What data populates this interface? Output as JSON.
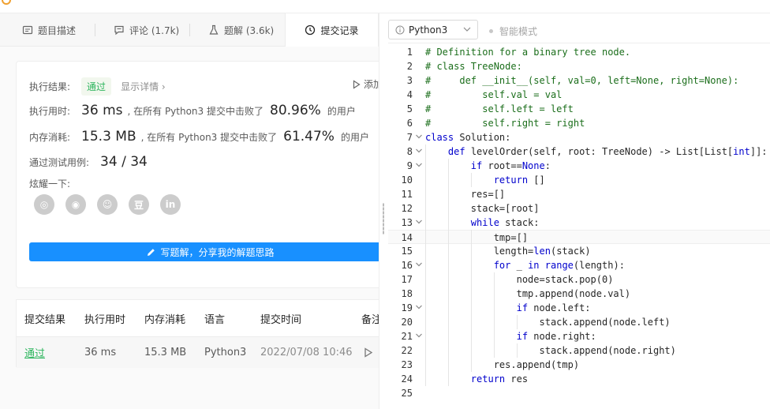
{
  "tabs": [
    {
      "label": "题目描述",
      "icon": "document-icon"
    },
    {
      "label": "评论 (1.7k)",
      "icon": "comment-icon"
    },
    {
      "label": "题解 (3.6k)",
      "icon": "flask-icon"
    },
    {
      "label": "提交记录",
      "icon": "clock-icon"
    }
  ],
  "result": {
    "label": "执行结果:",
    "status": "通过",
    "details_link": "显示详情 ›",
    "add_note": "添加备",
    "runtime_label": "执行用时:",
    "runtime_value": "36 ms",
    "runtime_text_a": ", 在所有 Python3 提交中击败了",
    "runtime_pct": "80.96%",
    "runtime_text_b": "的用户",
    "memory_label": "内存消耗:",
    "memory_value": "15.3 MB",
    "memory_text_a": ", 在所有 Python3 提交中击败了",
    "memory_pct": "61.47%",
    "memory_text_b": "的用户",
    "tests_label": "通过测试用例:",
    "tests_value": "34 / 34",
    "share_label": "炫耀一下:",
    "share_icons": [
      "wechat-icon",
      "weibo-icon",
      "qq-icon",
      "douban-icon",
      "linkedin-icon"
    ],
    "share_glyphs": [
      "◎",
      "◉",
      "☺",
      "豆",
      "in"
    ],
    "write_button": "写题解，分享我的解题思路"
  },
  "table": {
    "headers": [
      "提交结果",
      "执行用时",
      "内存消耗",
      "语言",
      "提交时间",
      "备注"
    ],
    "row": {
      "status": "通过",
      "runtime": "36 ms",
      "memory": "15.3 MB",
      "language": "Python3",
      "time": "2022/07/08 10:46"
    }
  },
  "editor": {
    "language": "Python3",
    "smart_mode": "智能模式",
    "current_line": 14,
    "lines": [
      "# Definition for a binary tree node.",
      "# class TreeNode:",
      "#     def __init__(self, val=0, left=None, right=None):",
      "#         self.val = val",
      "#         self.left = left",
      "#         self.right = right",
      "class Solution:",
      "    def levelOrder(self, root: TreeNode) -> List[List[int]]:",
      "        if root==None:",
      "            return []",
      "        res=[]",
      "        stack=[root]",
      "        while stack:",
      "            tmp=[]",
      "            length=len(stack)",
      "            for _ in range(length):",
      "                node=stack.pop(0)",
      "                tmp.append(node.val)",
      "                if node.left:",
      "                    stack.append(node.left)",
      "                if node.right:",
      "                    stack.append(node.right)",
      "            res.append(tmp)",
      "        return res",
      ""
    ],
    "fold_lines": [
      7,
      8,
      9,
      13,
      16,
      19,
      21
    ]
  },
  "colors": {
    "accent": "#1890ff",
    "success": "#2db55d",
    "keyword": "#0000cc",
    "comment": "#1b6e1b"
  }
}
